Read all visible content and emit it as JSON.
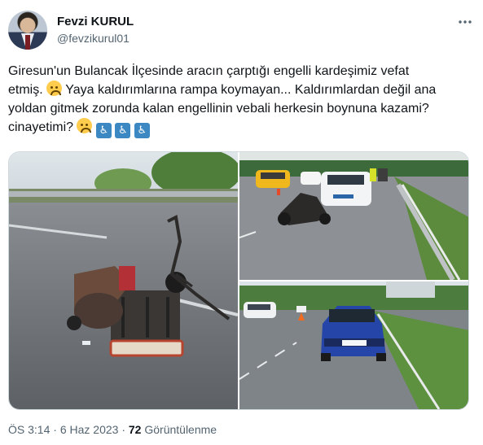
{
  "author": {
    "name": "Fevzi KURUL",
    "handle": "@fevzikurul01"
  },
  "tweet": {
    "line1": "Giresun'un Bulancak İlçesinde aracın çarptığı engelli kardeşimiz vefat",
    "line2_a": "etmiş.",
    "line2_b": " Yaya kaldırımlarına rampa koymayan... Kaldırımlardan değil ana",
    "line3": "yoldan gitmek zorunda kalan engellinin vebali herkesin boynuna kazami?",
    "line4": "cinayetimi?",
    "emojis": [
      "disappointed-face",
      "wheelchair-symbol",
      "wheelchair-symbol",
      "wheelchair-symbol"
    ]
  },
  "media": {
    "photos": [
      "wrecked-mobility-scooter",
      "accident-scene-police",
      "blue-suv-road"
    ],
    "plate_text": "34 NB 353"
  },
  "meta": {
    "time": "ÖS 3:14",
    "separator": "·",
    "date": "6 Haz 2023",
    "views_count": "72",
    "views_label": "Görüntülenme"
  },
  "colors": {
    "text": "#0f1419",
    "secondary": "#536471",
    "border": "#cfd9de"
  }
}
